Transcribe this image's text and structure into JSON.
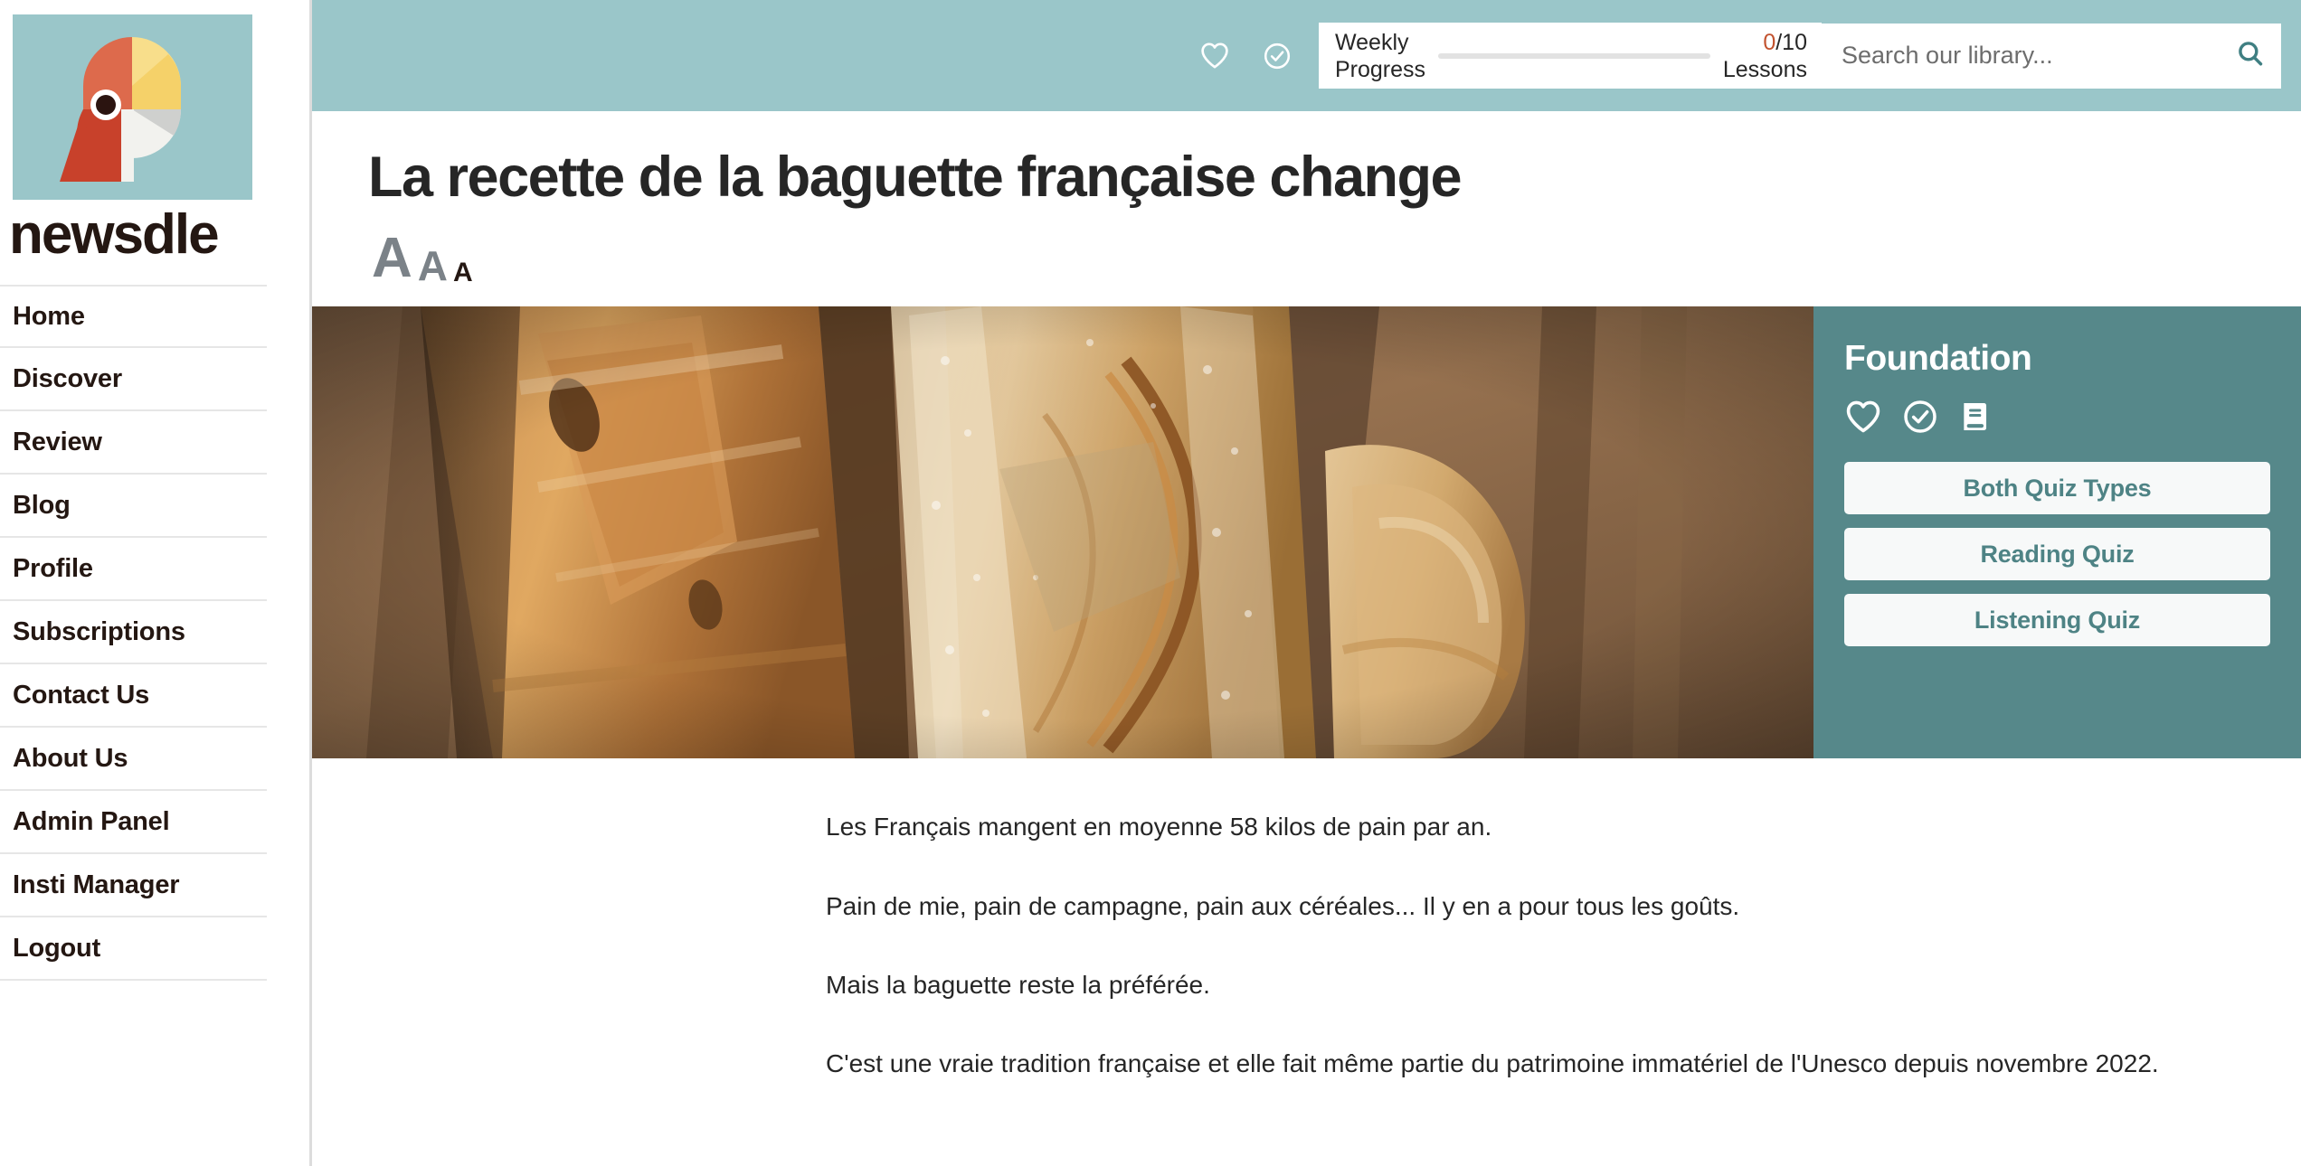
{
  "brand": {
    "wordmark": "newsdle",
    "logo_bg": "#9AC6C9",
    "logo_colors": {
      "top_left": "#DD6A4C",
      "bottom_left": "#C8412B",
      "top_right": "#F8DE8B",
      "top_right_shade": "#F5D169",
      "bottom_right": "#F2F2EE",
      "bottom_right_shade": "#CFD0CE",
      "eye": "#2B1410"
    }
  },
  "sidebar": {
    "items": [
      {
        "label": "Home"
      },
      {
        "label": "Discover"
      },
      {
        "label": "Review"
      },
      {
        "label": "Blog"
      },
      {
        "label": "Profile"
      },
      {
        "label": "Subscriptions"
      },
      {
        "label": "Contact Us"
      },
      {
        "label": "About Us"
      },
      {
        "label": "Admin Panel"
      },
      {
        "label": "Insti Manager"
      },
      {
        "label": "Logout"
      }
    ]
  },
  "topbar": {
    "background": "#9AC6C9",
    "favorite_icon": "heart-icon",
    "completed_icon": "check-circle-icon",
    "progress": {
      "label_line1": "Weekly",
      "label_line2": "Progress",
      "count": "0/10",
      "count_number": "0",
      "count_total": "/10",
      "unit": "Lessons",
      "percent": 0,
      "accent": "#C2522E"
    },
    "search": {
      "placeholder": "Search our library...",
      "value": "",
      "icon": "search-icon",
      "icon_color": "#3F7F82"
    }
  },
  "article": {
    "title": "La recette de la baguette française change",
    "font_sizes": [
      {
        "label": "A",
        "size": "large",
        "selected": false
      },
      {
        "label": "A",
        "size": "medium",
        "selected": false
      },
      {
        "label": "A",
        "size": "small",
        "selected": true
      }
    ],
    "hero_alt": "Close-up of rustic French baguettes",
    "paragraphs": [
      "Les Français mangent en moyenne 58 kilos de pain par an.",
      "Pain de mie, pain de campagne, pain aux céréales... Il y en a pour tous les goûts.",
      "Mais la baguette reste la préférée.",
      "C'est une vraie tradition française et elle fait même partie du patrimoine immatériel de l'Unesco depuis novembre 2022."
    ]
  },
  "panel": {
    "background": "#56888A",
    "title": "Foundation",
    "icons": [
      {
        "name": "heart-icon"
      },
      {
        "name": "check-circle-icon"
      },
      {
        "name": "book-icon"
      }
    ],
    "buttons": [
      {
        "label": "Both Quiz Types"
      },
      {
        "label": "Reading Quiz"
      },
      {
        "label": "Listening Quiz"
      }
    ],
    "button_text_color": "#4E8385"
  }
}
